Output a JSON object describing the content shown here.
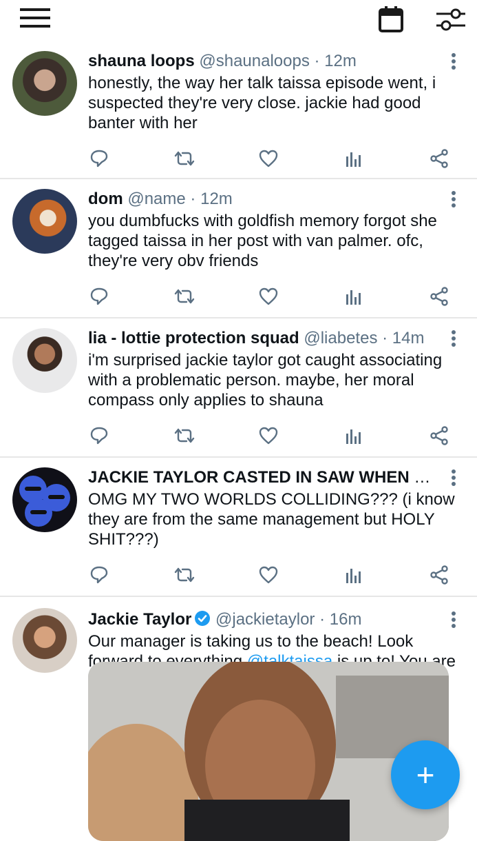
{
  "app": {
    "topbar": {
      "menu_icon": "hamburger-icon",
      "calendar_icon": "calendar-icon",
      "filter_icon": "sliders-icon"
    },
    "accent_color": "#1d9bf0",
    "text_color": "#0f1419",
    "muted_color": "#5b7083"
  },
  "tweets": [
    {
      "name": "shauna loops",
      "handle": "@shaunaloops",
      "sep": "·",
      "time": "12m",
      "text": "honestly, the way her talk taissa episode went, i suspected they're very close. jackie had good banter with her"
    },
    {
      "name": "dom",
      "handle": "@name",
      "sep": "·",
      "time": "12m",
      "text": "you dumbfucks with goldfish memory forgot she tagged taissa in her post with van palmer. ofc, they're very obv friends"
    },
    {
      "name": "lia - lottie protection squad",
      "handle": "@liabetes",
      "sep": "·",
      "time": "14m",
      "text": "i'm surprised jackie taylor got caught associating with a problematic person. maybe, her moral compass only applies to shauna"
    },
    {
      "name": "JACKIE TAYLOR CASTED IN SAW WHEN",
      "handle": "@...",
      "sep": "",
      "time": "",
      "text": "OMG MY TWO WORLDS COLLIDING??? (i know they are from  the same management but HOLY SHIT???)"
    },
    {
      "name": "Jackie Taylor",
      "handle": "@jackietaylor",
      "sep": "·",
      "time": "16m",
      "verified": true,
      "text_before": "Our manager is taking us to the beach! Look forward to everything ",
      "mention": "@talktaissa",
      "text_after": " is up to! You are in for a surprise! (I'm very surprised too)"
    }
  ],
  "fab": {
    "icon": "plus-icon",
    "label": "+"
  }
}
